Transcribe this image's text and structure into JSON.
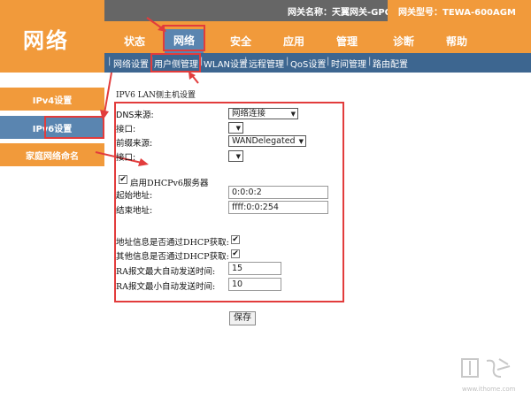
{
  "header": {
    "logo": "网络",
    "gateway_name": "网关名称：天翼网关-GPON",
    "gateway_model": "网关型号：TEWA-600AGM"
  },
  "nav": {
    "items": [
      {
        "label": "状态"
      },
      {
        "label": "网络"
      },
      {
        "label": "安全"
      },
      {
        "label": "应用"
      },
      {
        "label": "管理"
      },
      {
        "label": "诊断"
      },
      {
        "label": "帮助"
      }
    ],
    "active": "网络"
  },
  "subnav": {
    "items": [
      {
        "label": "网络设置"
      },
      {
        "label": "用户侧管理"
      },
      {
        "label": "WLAN设置"
      },
      {
        "label": "远程管理"
      },
      {
        "label": "QoS设置"
      },
      {
        "label": "时间管理"
      },
      {
        "label": "路由配置"
      }
    ],
    "separator": "|"
  },
  "sidebar": {
    "items": [
      {
        "label": "IPv4设置"
      },
      {
        "label": "IPv6设置"
      },
      {
        "label": "家庭网络命名"
      }
    ],
    "active": "IPv6设置"
  },
  "form": {
    "title": "IPV6 LAN侧主机设置",
    "dns_source_label": "DNS来源:",
    "dns_source_value": "网络连接",
    "interface1_label": "接口:",
    "interface1_value": "",
    "prefix_source_label": "前缀来源:",
    "prefix_source_value": "WANDelegated",
    "interface2_label": "接口:",
    "interface2_value": "",
    "dhcpv6_label": "启用DHCPv6服务器",
    "dhcpv6_checked": true,
    "start_addr_label": "起始地址:",
    "start_addr_value": "0:0:0:2",
    "end_addr_label": "结束地址:",
    "end_addr_value": "ffff:0:0:254",
    "addr_info_label": "地址信息是否通过DHCP获取:",
    "addr_info_checked": true,
    "other_info_label": "其他信息是否通过DHCP获取:",
    "other_info_checked": true,
    "ra_max_label": "RA报文最大自动发送时间:",
    "ra_max_value": "15",
    "ra_min_label": "RA报文最小自动发送时间:",
    "ra_min_value": "10",
    "save_label": "保存",
    "check_mark": "✔"
  },
  "watermark": {
    "url": "www.ithome.com"
  },
  "colors": {
    "orange": "#f19a3b",
    "blue_active": "#5a85b0",
    "subnav_blue": "#3d6690",
    "highlight_red": "#e23c3c",
    "topbar_gray": "#666666"
  }
}
